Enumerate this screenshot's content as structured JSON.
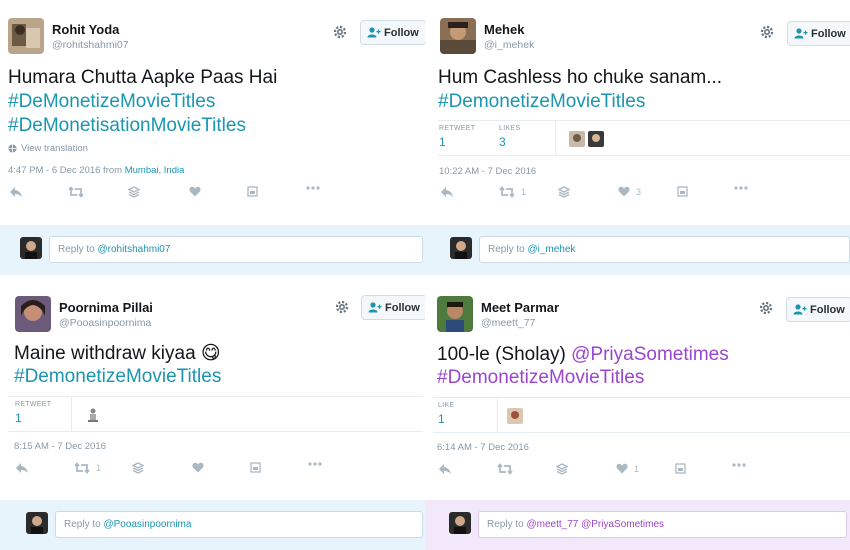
{
  "tweets": [
    {
      "name": "Rohit Yoda",
      "handle": "@rohitshahmi07",
      "follow_label": "Follow",
      "line1": "Humara Chutta Aapke Paas Hai",
      "line2": "#DeMonetizeMovieTitles",
      "line3": "#DeMonetisationMovieTitles",
      "view_translation": "View translation",
      "time": "4:47 PM - 6 Dec 2016 from ",
      "place": "Mumbai, India",
      "reply_prefix": "Reply to ",
      "reply_mention": "@rohitshahmi07"
    },
    {
      "name": "Mehek",
      "handle": "@i_mehek",
      "follow_label": "Follow",
      "line1": "Hum Cashless ho chuke sanam...",
      "line2": "#DemonetizeMovieTitles",
      "retweet_label": "RETWEET",
      "retweet_count": "1",
      "likes_label": "LIKES",
      "likes_count": "3",
      "time": "10:22 AM - 7 Dec 2016",
      "action_retweet_count": "1",
      "action_like_count": "3",
      "reply_prefix": "Reply to ",
      "reply_mention": "@i_mehek"
    },
    {
      "name": "Poornima Pillai",
      "handle": "@Pooasinpoornima",
      "follow_label": "Follow",
      "line1": "Maine withdraw kiyaa",
      "emoji": "😋",
      "line2": "#DemonetizeMovieTitles",
      "retweet_label": "RETWEET",
      "retweet_count": "1",
      "time": "8:15 AM - 7 Dec 2016",
      "action_retweet_count": "1",
      "reply_prefix": "Reply to ",
      "reply_mention": "@Pooasinpoornima"
    },
    {
      "name": "Meet Parmar",
      "handle": "@meett_77",
      "follow_label": "Follow",
      "line1_plain": "100-le (Sholay) ",
      "line1_mention": "@PriyaSometimes",
      "line2": "#DemonetizeMovieTitles",
      "like_label": "LIKE",
      "like_count": "1",
      "time": "6:14 AM - 7 Dec 2016",
      "action_like_count": "1",
      "reply_prefix": "Reply to ",
      "reply_mention": "@meett_77 @PriyaSometimes"
    }
  ],
  "colors": {
    "link": "#1b95b0",
    "purple": "#9b46ce",
    "muted": "#8899a6",
    "reply_bg_blue": "#e8f4fb",
    "reply_bg_purple": "#f3e8fa"
  }
}
